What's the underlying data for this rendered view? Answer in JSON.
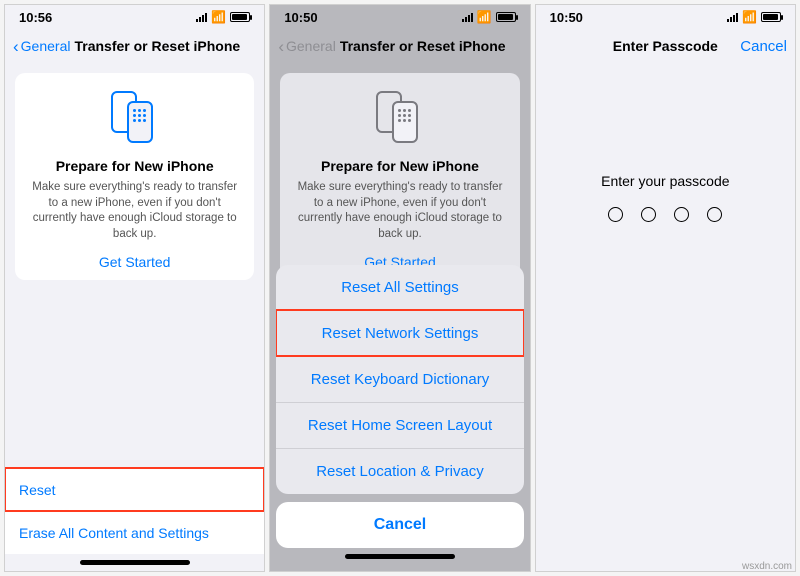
{
  "screen1": {
    "time": "10:56",
    "back": "General",
    "title": "Transfer or Reset iPhone",
    "card": {
      "title": "Prepare for New iPhone",
      "sub": "Make sure everything's ready to transfer to a new iPhone, even if you don't currently have enough iCloud storage to back up.",
      "cta": "Get Started"
    },
    "rows": {
      "reset": "Reset",
      "erase": "Erase All Content and Settings"
    }
  },
  "screen2": {
    "time": "10:50",
    "back": "General",
    "title": "Transfer or Reset iPhone",
    "card": {
      "title": "Prepare for New iPhone",
      "sub": "Make sure everything's ready to transfer to a new iPhone, even if you don't currently have enough iCloud storage to back up.",
      "cta": "Get Started"
    },
    "sheet": {
      "items": [
        "Reset All Settings",
        "Reset Network Settings",
        "Reset Keyboard Dictionary",
        "Reset Home Screen Layout",
        "Reset Location & Privacy"
      ],
      "cancel": "Cancel"
    }
  },
  "screen3": {
    "time": "10:50",
    "title": "Enter Passcode",
    "cancel": "Cancel",
    "prompt": "Enter your passcode"
  },
  "watermark": "wsxdn.com"
}
